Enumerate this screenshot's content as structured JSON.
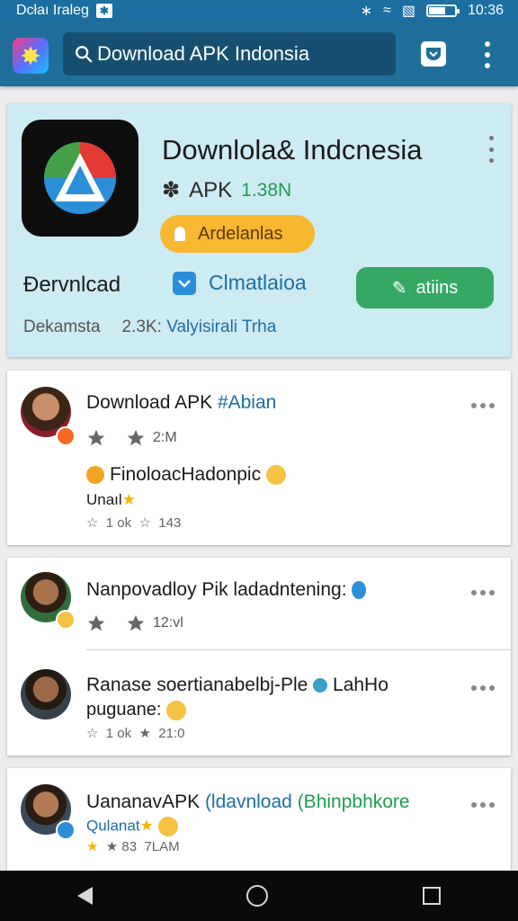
{
  "status_bar": {
    "carrier": "Dcłaı Iraleg",
    "time": "10:36",
    "battery_level": 0.6
  },
  "app_bar": {
    "search_text": "Download APK Indonsia"
  },
  "featured": {
    "title": "Downlola& Indcnesia",
    "type": "APK",
    "size": "1.38N",
    "pill_label": "Ardelanlas",
    "download_label": "Ðervnlcad",
    "secondary_label": "Clmatlaioa",
    "install_label": "atiins",
    "footer_left": "Dekamsta",
    "footer_count": "2.3K:",
    "footer_link": "Valyisirali Trha"
  },
  "feed": [
    {
      "title": "Download APK",
      "tag": "#Abian",
      "meta": "2:M",
      "body": "FinoloacHadonpic",
      "sub": "Unaıl",
      "stats": "1 ok",
      "stats2": "143"
    },
    {
      "title": "Nanpovadloy Pik ladadntening:",
      "meta": "12:vl"
    },
    {
      "title": "Ranase soertianabelbj-Ple",
      "title_tail": "LahHo",
      "sub": "puguane:",
      "stats": "1 ok",
      "stats2": "21:0"
    },
    {
      "title": "UananavAPK",
      "link1": "(ldavnload",
      "link2": "(Bhinpbhkore",
      "sub": "Qulanat",
      "stats": "83",
      "stats2": "7LAM"
    }
  ]
}
